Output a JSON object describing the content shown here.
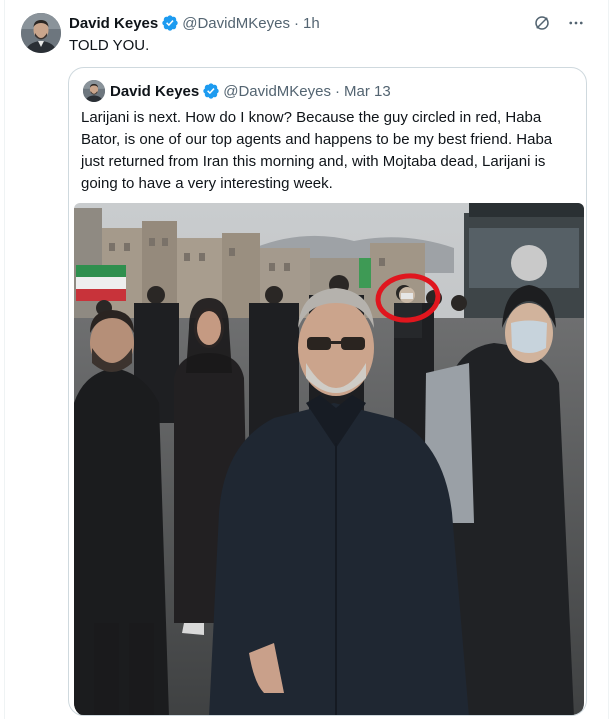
{
  "tweet": {
    "author_name": "David Keyes",
    "author_handle": "@DavidMKeyes",
    "separator": "·",
    "timestamp": "1h",
    "text": "TOLD YOU.",
    "more_icon": "more-horizontal-icon",
    "grok_icon": "slashed-circle-icon"
  },
  "quoted_tweet": {
    "author_name": "David Keyes",
    "author_handle": "@DavidMKeyes",
    "separator": "·",
    "timestamp": "Mar 13",
    "text": "Larijani is next. How do I know? Because the guy circled in red, Haba Bator, is one of our top agents and happens to be my best friend. Haba just returned from Iran this morning and, with Mojtaba dead, Larijani is going to have a very interesting week.",
    "media": {
      "type": "photo",
      "annotation": "red-circle",
      "annotation_color": "#e0161e"
    }
  },
  "colors": {
    "verified_badge": "#1d9bf0",
    "text_primary": "#0f1419",
    "text_secondary": "#536471",
    "border": "#cfd9de"
  }
}
